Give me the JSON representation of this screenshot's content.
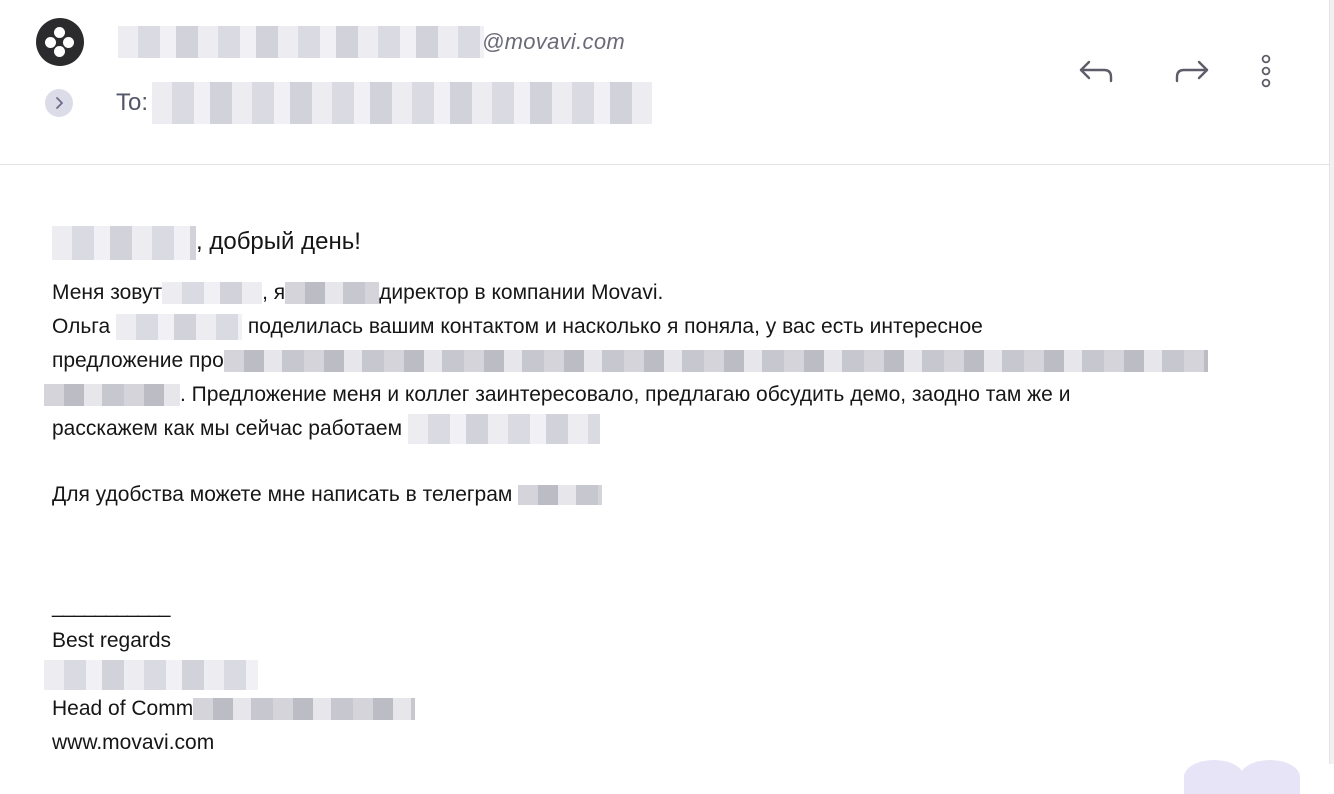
{
  "header": {
    "sender_email_suffix": "@movavi.com",
    "to_label": "To:",
    "icons": {
      "avatar": "movavi-logo-icon",
      "expand": "chevron-right-icon",
      "reply": "reply-icon",
      "forward": "forward-icon",
      "more": "more-vertical-icon"
    }
  },
  "body": {
    "greeting": ", добрый день!",
    "p1_a": "Меня зовут",
    "p1_b": ", я",
    "p1_c": "директор в компании Movavi.",
    "p2_a": "Ольга",
    "p2_b": "поделилась вашим контактом и насколько я поняла, у вас есть интересное",
    "p3_a": "предложение про",
    "p4_a": ". Предложение меня и коллег заинтересовало, предлагаю обсудить демо, заодно там же и",
    "p5_a": "расскажем как мы сейчас работаем",
    "p6_a": "Для удобства можете мне написать в телеграм"
  },
  "signature": {
    "rule": "___________",
    "closing": "Best regards",
    "title_prefix": "Head of Comm",
    "website": "www.movavi.com"
  },
  "colors": {
    "avatar_bg": "#2b2b2d",
    "accent_chip": "#dcdbe8",
    "muted_text": "#6b6b78",
    "icon_color": "#5d5d6a"
  }
}
